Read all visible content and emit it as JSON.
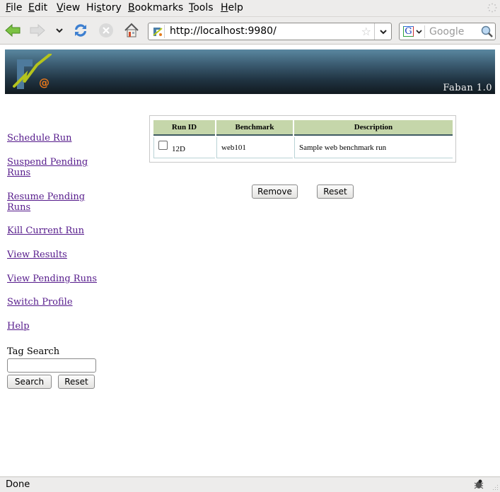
{
  "browser": {
    "menu": [
      {
        "label": "File",
        "accel": "F",
        "rest": "ile"
      },
      {
        "label": "Edit",
        "accel": "E",
        "rest": "dit"
      },
      {
        "label": "View",
        "accel": "V",
        "rest": "iew"
      },
      {
        "label": "History",
        "pre": "Hi",
        "accel": "s",
        "rest": "tory"
      },
      {
        "label": "Bookmarks",
        "accel": "B",
        "rest": "ookmarks"
      },
      {
        "label": "Tools",
        "accel": "T",
        "rest": "ools"
      },
      {
        "label": "Help",
        "accel": "H",
        "rest": "elp"
      }
    ],
    "url": "http://localhost:9980/",
    "search_placeholder": "Google",
    "status": "Done"
  },
  "page": {
    "app_version": "Faban  1.0",
    "nav": [
      {
        "line1": "Schedule Run"
      },
      {
        "line1": "Suspend Pending",
        "line2": "Runs"
      },
      {
        "line1": "Resume Pending",
        "line2": "Runs"
      },
      {
        "line1": "Kill Current Run"
      },
      {
        "line1": "View Results"
      },
      {
        "line1": "View Pending Runs"
      },
      {
        "line1": "Switch Profile"
      },
      {
        "line1": "Help"
      }
    ],
    "tag_search": {
      "label": "Tag Search",
      "value": "",
      "search_button": "Search",
      "reset_button": "Reset"
    },
    "runs_table": {
      "columns": [
        "Run ID",
        "Benchmark",
        "Description"
      ],
      "rows": [
        {
          "run_id": "12D",
          "benchmark": "web101",
          "description": "Sample web benchmark run",
          "checked": false
        }
      ]
    },
    "actions": {
      "remove": "Remove",
      "reset": "Reset"
    }
  },
  "colors": {
    "link": "#551a8b",
    "table_header_bg": "#c5d6aa",
    "table_header_rule": "#3f5a63",
    "banner_top": "#5a87a0",
    "banner_bottom": "#111a20"
  }
}
